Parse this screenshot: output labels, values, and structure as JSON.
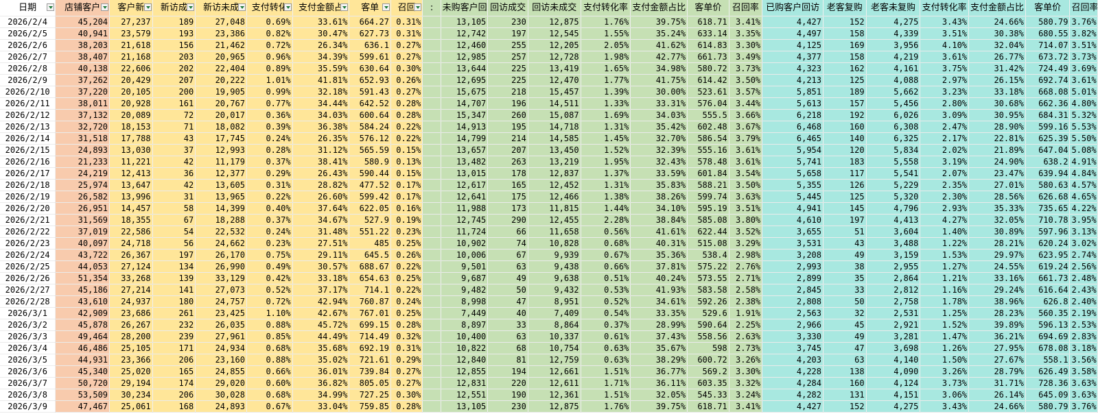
{
  "headers": [
    {
      "label": "日期",
      "filter": true,
      "group": "g-w"
    },
    {
      "label": "店铺客户",
      "filter": true,
      "group": "g-s"
    },
    {
      "label": "客户新",
      "filter": true,
      "group": "g-y"
    },
    {
      "label": "新访成",
      "filter": true,
      "group": "g-y"
    },
    {
      "label": "新访未成",
      "filter": true,
      "group": "g-y"
    },
    {
      "label": "支付转化",
      "filter": true,
      "group": "g-y"
    },
    {
      "label": "支付金额占",
      "filter": true,
      "group": "g-y"
    },
    {
      "label": "客单",
      "filter": true,
      "group": "g-y"
    },
    {
      "label": "召回",
      "filter": true,
      "group": "g-y"
    },
    {
      "label": ":",
      "filter": false,
      "group": "g-gr"
    },
    {
      "label": "未购客户回",
      "filter": false,
      "group": "g-gr"
    },
    {
      "label": "回访成交",
      "filter": false,
      "group": "g-gr"
    },
    {
      "label": "回访未成交",
      "filter": false,
      "group": "g-gr"
    },
    {
      "label": "支付转化率",
      "filter": false,
      "group": "g-gr"
    },
    {
      "label": "支付金额占比",
      "filter": false,
      "group": "g-gr"
    },
    {
      "label": "客单价",
      "filter": false,
      "group": "g-gr"
    },
    {
      "label": "召回率",
      "filter": false,
      "group": "g-gr"
    },
    {
      "label": "已购客户回访",
      "filter": false,
      "group": "g-t"
    },
    {
      "label": "老客复购",
      "filter": false,
      "group": "g-t"
    },
    {
      "label": "老客未复购",
      "filter": false,
      "group": "g-t"
    },
    {
      "label": "支付转化率",
      "filter": false,
      "group": "g-t"
    },
    {
      "label": "支付金额占比",
      "filter": false,
      "group": "g-t"
    },
    {
      "label": "客单价",
      "filter": false,
      "group": "g-t"
    },
    {
      "label": "召回率",
      "filter": false,
      "group": "g-t"
    }
  ],
  "rows": [
    [
      "2026/2/4",
      "45,204",
      "27,237",
      "189",
      "27,048",
      "0.69%",
      "33.61%",
      "664.27",
      "0.31%",
      "",
      "13,105",
      "230",
      "12,875",
      "1.76%",
      "39.75%",
      "618.71",
      "3.41%",
      "4,427",
      "152",
      "4,275",
      "3.43%",
      "24.66%",
      "580.79",
      "3.76%"
    ],
    [
      "2026/2/5",
      "40,941",
      "23,579",
      "193",
      "23,386",
      "0.82%",
      "30.47%",
      "627.73",
      "0.31%",
      "",
      "12,742",
      "197",
      "12,545",
      "1.55%",
      "35.24%",
      "633.14",
      "3.35%",
      "4,497",
      "158",
      "4,339",
      "3.51%",
      "30.38%",
      "680.55",
      "3.82%"
    ],
    [
      "2026/2/6",
      "38,203",
      "21,618",
      "156",
      "21,462",
      "0.72%",
      "26.34%",
      "636.1",
      "0.27%",
      "",
      "12,460",
      "255",
      "12,205",
      "2.05%",
      "41.62%",
      "614.83",
      "3.30%",
      "4,125",
      "169",
      "3,956",
      "4.10%",
      "32.04%",
      "714.07",
      "3.51%"
    ],
    [
      "2026/2/7",
      "38,407",
      "21,168",
      "203",
      "20,965",
      "0.96%",
      "34.39%",
      "599.61",
      "0.27%",
      "",
      "12,985",
      "257",
      "12,728",
      "1.98%",
      "42.77%",
      "661.73",
      "3.49%",
      "4,377",
      "158",
      "4,219",
      "3.61%",
      "26.77%",
      "673.72",
      "3.73%"
    ],
    [
      "2026/2/8",
      "40,138",
      "22,606",
      "202",
      "22,404",
      "0.89%",
      "35.59%",
      "630.64",
      "0.30%",
      "",
      "13,644",
      "225",
      "13,419",
      "1.65%",
      "34.98%",
      "580.72",
      "3.73%",
      "4,323",
      "162",
      "4,161",
      "3.75%",
      "31.42%",
      "724.49",
      "3.69%"
    ],
    [
      "2026/2/9",
      "37,262",
      "20,429",
      "207",
      "20,222",
      "1.01%",
      "41.81%",
      "652.93",
      "0.26%",
      "",
      "12,695",
      "225",
      "12,470",
      "1.77%",
      "41.75%",
      "614.42",
      "3.50%",
      "4,213",
      "125",
      "4,088",
      "2.97%",
      "26.15%",
      "692.74",
      "3.61%"
    ],
    [
      "2026/2/10",
      "37,220",
      "20,105",
      "200",
      "19,905",
      "0.99%",
      "32.18%",
      "591.43",
      "0.27%",
      "",
      "15,675",
      "218",
      "15,457",
      "1.39%",
      "30.00%",
      "523.61",
      "3.57%",
      "5,851",
      "189",
      "5,662",
      "3.23%",
      "33.18%",
      "668.08",
      "5.01%"
    ],
    [
      "2026/2/11",
      "38,011",
      "20,928",
      "161",
      "20,767",
      "0.77%",
      "34.44%",
      "642.52",
      "0.28%",
      "",
      "14,707",
      "196",
      "14,511",
      "1.33%",
      "33.31%",
      "576.04",
      "3.44%",
      "5,613",
      "157",
      "5,456",
      "2.80%",
      "30.68%",
      "662.36",
      "4.80%"
    ],
    [
      "2026/2/12",
      "37,132",
      "20,089",
      "72",
      "20,017",
      "0.36%",
      "34.03%",
      "600.64",
      "0.28%",
      "",
      "15,347",
      "260",
      "15,087",
      "1.69%",
      "34.03%",
      "555.5",
      "3.66%",
      "6,218",
      "192",
      "6,026",
      "3.09%",
      "30.95%",
      "684.31",
      "5.32%"
    ],
    [
      "2026/2/13",
      "32,720",
      "18,153",
      "71",
      "18,082",
      "0.39%",
      "36.38%",
      "584.24",
      "0.22%",
      "",
      "14,913",
      "195",
      "14,718",
      "1.31%",
      "35.42%",
      "602.48",
      "3.67%",
      "6,468",
      "160",
      "6,308",
      "2.47%",
      "28.90%",
      "599.16",
      "5.53%"
    ],
    [
      "2026/2/14",
      "31,518",
      "17,788",
      "43",
      "17,745",
      "0.24%",
      "26.35%",
      "576.12",
      "0.22%",
      "",
      "14,799",
      "214",
      "14,585",
      "1.45%",
      "32.70%",
      "586.54",
      "3.79%",
      "6,465",
      "140",
      "6,325",
      "2.17%",
      "22.81%",
      "625.39",
      "5.50%"
    ],
    [
      "2026/2/15",
      "24,893",
      "13,030",
      "37",
      "12,993",
      "0.28%",
      "31.12%",
      "565.59",
      "0.15%",
      "",
      "13,657",
      "207",
      "13,450",
      "1.52%",
      "32.39%",
      "555.16",
      "3.61%",
      "5,954",
      "120",
      "5,834",
      "2.02%",
      "21.89%",
      "647.04",
      "5.08%"
    ],
    [
      "2026/2/16",
      "21,233",
      "11,221",
      "42",
      "11,179",
      "0.37%",
      "38.41%",
      "580.9",
      "0.13%",
      "",
      "13,482",
      "263",
      "13,219",
      "1.95%",
      "32.43%",
      "578.48",
      "3.61%",
      "5,741",
      "183",
      "5,558",
      "3.19%",
      "24.90%",
      "638.2",
      "4.91%"
    ],
    [
      "2026/2/17",
      "24,219",
      "12,413",
      "36",
      "12,377",
      "0.29%",
      "26.43%",
      "590.44",
      "0.15%",
      "",
      "13,015",
      "178",
      "12,837",
      "1.37%",
      "33.59%",
      "601.84",
      "3.54%",
      "5,658",
      "117",
      "5,541",
      "2.07%",
      "23.47%",
      "639.94",
      "4.84%"
    ],
    [
      "2026/2/18",
      "25,974",
      "13,647",
      "42",
      "13,605",
      "0.31%",
      "28.82%",
      "477.52",
      "0.17%",
      "",
      "12,617",
      "165",
      "12,452",
      "1.31%",
      "35.83%",
      "588.21",
      "3.50%",
      "5,355",
      "126",
      "5,229",
      "2.35%",
      "27.01%",
      "580.63",
      "4.57%"
    ],
    [
      "2026/2/19",
      "26,582",
      "13,996",
      "31",
      "13,965",
      "0.22%",
      "26.60%",
      "599.42",
      "0.17%",
      "",
      "12,641",
      "175",
      "12,466",
      "1.38%",
      "38.26%",
      "599.74",
      "3.63%",
      "5,445",
      "125",
      "5,320",
      "2.30%",
      "28.56%",
      "626.68",
      "4.65%"
    ],
    [
      "2026/2/20",
      "26,951",
      "14,457",
      "58",
      "14,399",
      "0.40%",
      "37.64%",
      "622.05",
      "0.16%",
      "",
      "11,988",
      "173",
      "11,815",
      "1.44%",
      "34.10%",
      "595.19",
      "3.51%",
      "4,941",
      "145",
      "4,796",
      "2.93%",
      "35.33%",
      "735.65",
      "4.22%"
    ],
    [
      "2026/2/21",
      "31,569",
      "18,355",
      "67",
      "18,288",
      "0.37%",
      "34.67%",
      "527.9",
      "0.19%",
      "",
      "12,745",
      "290",
      "12,455",
      "2.28%",
      "38.84%",
      "585.08",
      "3.80%",
      "4,610",
      "197",
      "4,413",
      "4.27%",
      "32.05%",
      "710.78",
      "3.95%"
    ],
    [
      "2026/2/22",
      "37,019",
      "22,586",
      "54",
      "22,532",
      "0.24%",
      "31.48%",
      "551.22",
      "0.23%",
      "",
      "11,724",
      "66",
      "11,658",
      "0.56%",
      "41.61%",
      "622.44",
      "3.52%",
      "3,655",
      "51",
      "3,604",
      "1.40%",
      "30.89%",
      "597.96",
      "3.13%"
    ],
    [
      "2026/2/23",
      "40,097",
      "24,718",
      "56",
      "24,662",
      "0.23%",
      "27.51%",
      "485",
      "0.25%",
      "",
      "10,902",
      "74",
      "10,828",
      "0.68%",
      "40.31%",
      "515.08",
      "3.29%",
      "3,531",
      "43",
      "3,488",
      "1.22%",
      "28.21%",
      "620.24",
      "3.02%"
    ],
    [
      "2026/2/24",
      "43,722",
      "26,367",
      "197",
      "26,170",
      "0.75%",
      "29.11%",
      "645.5",
      "0.26%",
      "",
      "10,006",
      "67",
      "9,939",
      "0.67%",
      "35.36%",
      "538.4",
      "2.98%",
      "3,208",
      "49",
      "3,159",
      "1.53%",
      "29.97%",
      "623.95",
      "2.74%"
    ],
    [
      "2026/2/25",
      "44,053",
      "27,124",
      "134",
      "26,990",
      "0.49%",
      "30.57%",
      "688.67",
      "0.22%",
      "",
      "9,501",
      "63",
      "9,438",
      "0.66%",
      "37.81%",
      "575.22",
      "2.76%",
      "2,993",
      "38",
      "2,955",
      "1.27%",
      "24.55%",
      "619.24",
      "2.56%"
    ],
    [
      "2026/2/26",
      "51,354",
      "33,268",
      "139",
      "33,129",
      "0.42%",
      "33.18%",
      "654.63",
      "0.25%",
      "",
      "9,687",
      "49",
      "9,638",
      "0.51%",
      "40.24%",
      "573.55",
      "2.71%",
      "2,899",
      "35",
      "2,864",
      "1.21%",
      "33.16%",
      "661.73",
      "2.48%"
    ],
    [
      "2026/2/27",
      "45,186",
      "27,214",
      "141",
      "27,073",
      "0.52%",
      "37.17%",
      "714.1",
      "0.22%",
      "",
      "9,482",
      "50",
      "9,432",
      "0.53%",
      "41.93%",
      "583.58",
      "2.58%",
      "2,845",
      "33",
      "2,812",
      "1.16%",
      "29.24%",
      "616.64",
      "2.43%"
    ],
    [
      "2026/2/28",
      "43,610",
      "24,937",
      "180",
      "24,757",
      "0.72%",
      "42.94%",
      "760.87",
      "0.24%",
      "",
      "8,998",
      "47",
      "8,951",
      "0.52%",
      "34.61%",
      "592.26",
      "2.38%",
      "2,808",
      "50",
      "2,758",
      "1.78%",
      "38.96%",
      "626.8",
      "2.40%"
    ],
    [
      "2026/3/1",
      "42,909",
      "23,686",
      "261",
      "23,425",
      "1.10%",
      "42.67%",
      "767.01",
      "0.25%",
      "",
      "7,449",
      "40",
      "7,409",
      "0.54%",
      "33.35%",
      "529.6",
      "1.91%",
      "2,563",
      "32",
      "2,531",
      "1.25%",
      "28.23%",
      "560.35",
      "2.19%"
    ],
    [
      "2026/3/2",
      "45,878",
      "26,267",
      "232",
      "26,035",
      "0.88%",
      "45.72%",
      "699.15",
      "0.28%",
      "",
      "8,897",
      "33",
      "8,864",
      "0.37%",
      "28.99%",
      "590.64",
      "2.25%",
      "2,966",
      "45",
      "2,921",
      "1.52%",
      "39.89%",
      "596.13",
      "2.53%"
    ],
    [
      "2026/3/3",
      "49,464",
      "28,200",
      "239",
      "27,961",
      "0.85%",
      "44.49%",
      "714.49",
      "0.32%",
      "",
      "10,400",
      "63",
      "10,337",
      "0.61%",
      "37.43%",
      "558.56",
      "2.63%",
      "3,330",
      "49",
      "3,281",
      "1.47%",
      "36.21%",
      "694.69",
      "2.83%"
    ],
    [
      "2026/3/4",
      "46,486",
      "25,105",
      "171",
      "24,934",
      "0.68%",
      "35.68%",
      "692.19",
      "0.31%",
      "",
      "10,822",
      "68",
      "10,754",
      "0.63%",
      "35.67%",
      "598",
      "2.73%",
      "3,745",
      "47",
      "3,698",
      "1.26%",
      "27.95%",
      "678.08",
      "3.18%"
    ],
    [
      "2026/3/5",
      "44,931",
      "23,366",
      "206",
      "23,160",
      "0.88%",
      "35.02%",
      "721.61",
      "0.29%",
      "",
      "12,840",
      "81",
      "12,759",
      "0.63%",
      "38.29%",
      "600.72",
      "3.26%",
      "4,203",
      "63",
      "4,140",
      "1.50%",
      "27.67%",
      "558.1",
      "3.56%"
    ],
    [
      "2026/3/6",
      "45,340",
      "25,020",
      "165",
      "24,855",
      "0.66%",
      "36.01%",
      "739.84",
      "0.27%",
      "",
      "12,855",
      "194",
      "12,661",
      "1.51%",
      "36.77%",
      "569.2",
      "3.30%",
      "4,228",
      "138",
      "4,090",
      "3.26%",
      "28.79%",
      "626.49",
      "3.58%"
    ],
    [
      "2026/3/7",
      "50,720",
      "29,194",
      "174",
      "29,020",
      "0.60%",
      "36.82%",
      "805.05",
      "0.27%",
      "",
      "12,831",
      "220",
      "12,611",
      "1.71%",
      "36.11%",
      "603.35",
      "3.32%",
      "4,284",
      "160",
      "4,124",
      "3.73%",
      "31.71%",
      "728.36",
      "3.63%"
    ],
    [
      "2026/3/8",
      "53,509",
      "30,234",
      "206",
      "30,028",
      "0.68%",
      "34.99%",
      "727.25",
      "0.30%",
      "",
      "12,551",
      "190",
      "12,361",
      "1.51%",
      "32.05%",
      "545.33",
      "3.24%",
      "4,282",
      "131",
      "4,151",
      "3.06%",
      "26.14%",
      "645.09",
      "3.63%"
    ],
    [
      "2026/3/9",
      "47,467",
      "25,061",
      "168",
      "24,893",
      "0.67%",
      "33.04%",
      "759.85",
      "0.28%",
      "",
      "13,105",
      "230",
      "12,875",
      "1.76%",
      "39.75%",
      "618.71",
      "3.41%",
      "4,427",
      "152",
      "4,275",
      "3.43%",
      "24.66%",
      "580.79",
      "3.76%"
    ]
  ],
  "column_groups": {
    "g-w": "#ffffff",
    "g-s": "#f8cbad",
    "g-y": "#ffe699",
    "g-gr": "#c6e0b4",
    "g-t": "#a8e8e0"
  },
  "filter_icon": "dropdown-filter-icon"
}
